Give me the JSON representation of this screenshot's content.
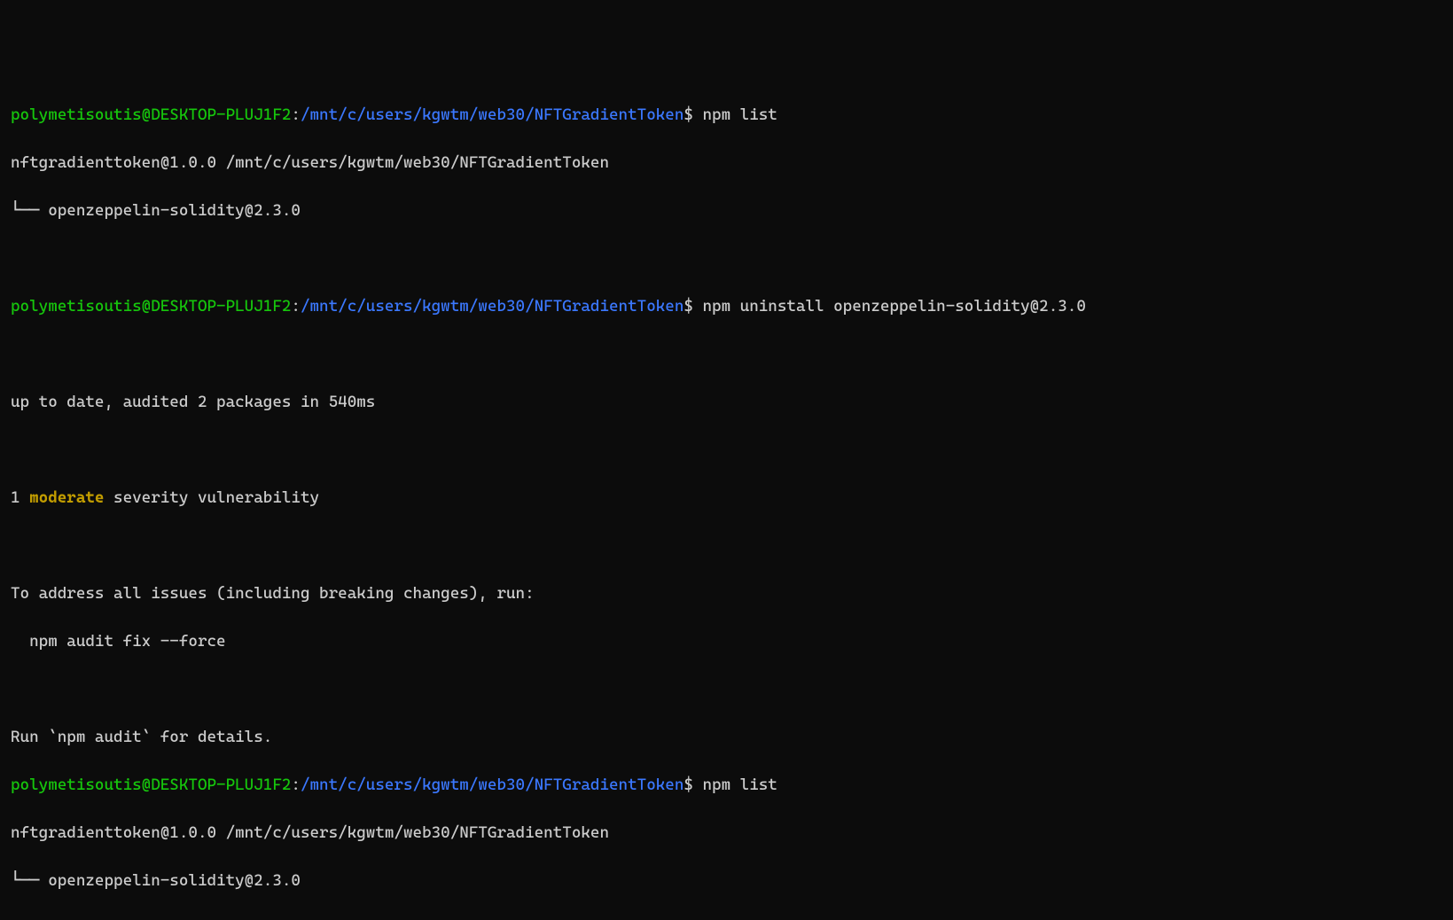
{
  "prompt": {
    "user": "polymetisoutis@DESKTOP-PLUJ1F2",
    "colon": ":",
    "path": "/mnt/c/users/kgwtm/web30/NFTGradientToken",
    "dollar": "$"
  },
  "cmd1": "npm list",
  "out1_line1": "nftgradienttoken@1.0.0 /mnt/c/users/kgwtm/web30/NFTGradientToken",
  "out1_line2": "└── openzeppelin-solidity@2.3.0",
  "cmd2": "npm uninstall openzeppelin-solidity@2.3.0",
  "out2_line1": "up to date, audited 2 packages in 540ms",
  "out2_sev_before": "1 ",
  "out2_sev_word": "moderate",
  "out2_sev_after": " severity vulnerability",
  "out2_line3": "To address all issues (including breaking changes), run:",
  "out2_line4": "  npm audit fix --force",
  "out2_line5": "Run `npm audit` for details.",
  "cmd3": "npm list",
  "out3_line1": "nftgradienttoken@1.0.0 /mnt/c/users/kgwtm/web30/NFTGradientToken",
  "out3_line2": "└── openzeppelin-solidity@2.3.0"
}
